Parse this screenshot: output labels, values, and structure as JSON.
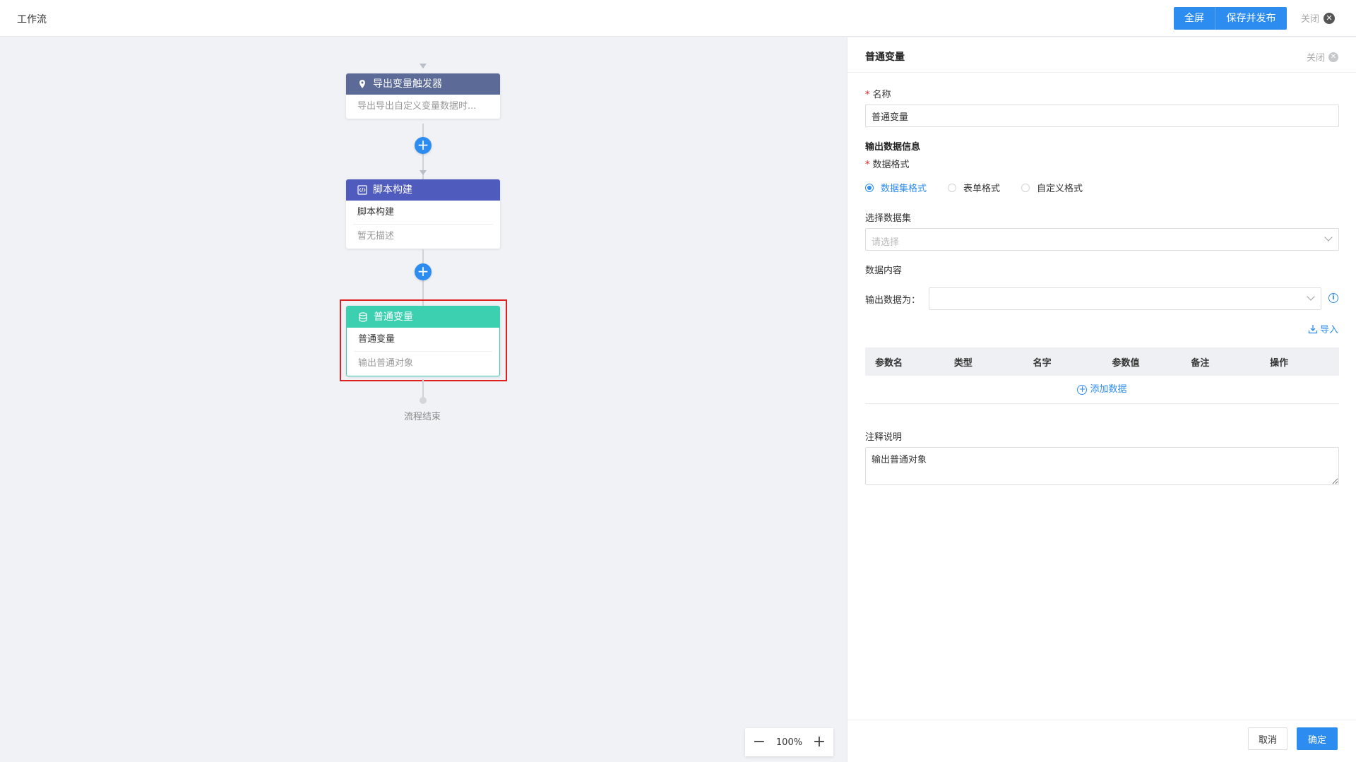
{
  "header": {
    "title": "工作流",
    "fullscreen_label": "全屏",
    "save_publish_label": "保存并发布",
    "close_label": "关闭"
  },
  "flow": {
    "nodes": [
      {
        "title": "导出变量触发器",
        "lines": [
          "导出导出自定义变量数据时..."
        ],
        "color": "#5b6a96",
        "icon": "map-pin-icon"
      },
      {
        "title": "脚本构建",
        "lines": [
          "脚本构建",
          "暂无描述"
        ],
        "color": "#4f5bbd",
        "icon": "code-icon"
      },
      {
        "title": "普通变量",
        "lines": [
          "普通变量",
          "输出普通对象"
        ],
        "color": "#3ccfb0",
        "icon": "database-icon",
        "selected": true
      }
    ],
    "end_label": "流程结束"
  },
  "zoom": {
    "value": "100%"
  },
  "panel": {
    "title": "普通变量",
    "close_label": "关闭",
    "name_label": "名称",
    "name_value": "普通变量",
    "output_section": "输出数据信息",
    "format_label": "数据格式",
    "formats": [
      "数据集格式",
      "表单格式",
      "自定义格式"
    ],
    "selected_format": "数据集格式",
    "dataset_label": "选择数据集",
    "dataset_placeholder": "请选择",
    "content_label": "数据内容",
    "output_as_label": "输出数据为：",
    "import_label": "导入",
    "table_headers": [
      "参数名",
      "类型",
      "名字",
      "参数值",
      "备注",
      "操作"
    ],
    "add_data_label": "添加数据",
    "note_label": "注释说明",
    "note_value": "输出普通对象",
    "cancel_label": "取消",
    "ok_label": "确定"
  },
  "colors": {
    "primary": "#2d8cf0",
    "danger": "#e02020"
  }
}
